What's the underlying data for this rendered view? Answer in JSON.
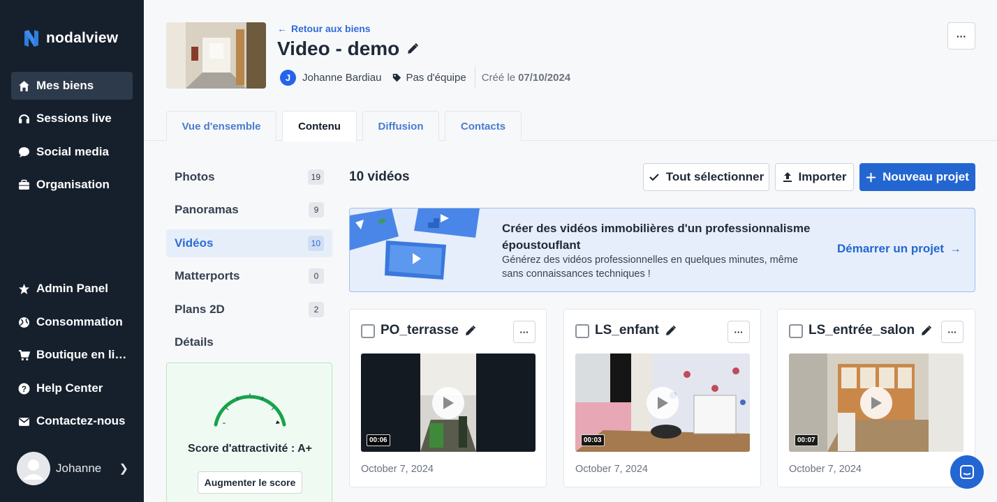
{
  "app": {
    "brand": "nodalview"
  },
  "sidebar": {
    "items": [
      {
        "label": "Mes biens",
        "icon": "home-icon",
        "active": true
      },
      {
        "label": "Sessions live",
        "icon": "headset-icon"
      },
      {
        "label": "Social media",
        "icon": "chat-bubble-icon"
      },
      {
        "label": "Organisation",
        "icon": "briefcase-icon"
      }
    ],
    "bottom_items": [
      {
        "label": "Admin Panel",
        "icon": "star-icon"
      },
      {
        "label": "Consommation",
        "icon": "globe-icon"
      },
      {
        "label": "Boutique en ligne",
        "icon": "cart-icon"
      },
      {
        "label": "Help Center",
        "icon": "question-circle-icon"
      },
      {
        "label": "Contactez-nous",
        "icon": "envelope-icon"
      }
    ],
    "user": {
      "name": "Johanne"
    }
  },
  "header": {
    "back_label": "Retour aux biens",
    "title": "Video - demo",
    "owner_initial": "J",
    "owner_name": "Johanne Bardiau",
    "team_label": "Pas d'équipe",
    "created_label": "Créé le",
    "created_date": "07/10/2024",
    "more_label": "···"
  },
  "tabs": [
    {
      "label": "Vue d'ensemble"
    },
    {
      "label": "Contenu",
      "active": true
    },
    {
      "label": "Diffusion"
    },
    {
      "label": "Contacts"
    }
  ],
  "content_menu": [
    {
      "label": "Photos",
      "count": "19"
    },
    {
      "label": "Panoramas",
      "count": "9"
    },
    {
      "label": "Vidéos",
      "count": "10",
      "active": true
    },
    {
      "label": "Matterports",
      "count": "0"
    },
    {
      "label": "Plans 2D",
      "count": "2"
    },
    {
      "label": "Détails"
    }
  ],
  "score": {
    "label": "Score d'attractivité : A+",
    "button": "Augmenter le score"
  },
  "videos": {
    "count_label": "10 vidéos",
    "select_all": "Tout sélectionner",
    "import": "Importer",
    "new_project": "Nouveau projet"
  },
  "promo": {
    "title": "Créer des vidéos immobilières d'un professionnalisme époustouflant",
    "description": "Générez des vidéos professionnelles en quelques minutes, même sans connaissances techniques !",
    "link": "Démarrer un projet"
  },
  "cards": [
    {
      "title": "PO_terrasse",
      "duration": "00:06",
      "date": "October 7, 2024"
    },
    {
      "title": "LS_enfant",
      "duration": "00:03",
      "date": "October 7, 2024"
    },
    {
      "title": "LS_entrée_salon",
      "duration": "00:07",
      "date": "October 7, 2024"
    }
  ],
  "colors": {
    "primary": "#2366d1",
    "sidebar": "#16202d",
    "score_green": "#16a34a"
  }
}
